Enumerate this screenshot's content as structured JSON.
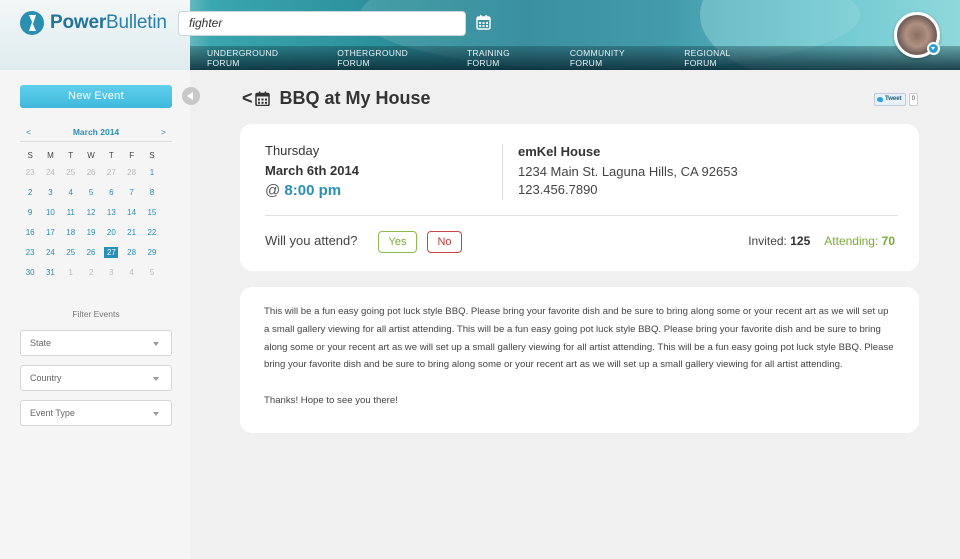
{
  "header": {
    "logo_part1": "Power",
    "logo_part2": "Bulletin",
    "search_value": "fighter",
    "nav": [
      "UNDERGROUND FORUM",
      "OTHERGROUND FORUM",
      "TRAINING FORUM",
      "COMMUNITY FORUM",
      "REGIONAL FORUM"
    ]
  },
  "sidebar": {
    "new_event_label": "New Event",
    "calendar": {
      "prev": "<",
      "month": "March 2014",
      "next": ">",
      "dow": [
        "S",
        "M",
        "T",
        "W",
        "T",
        "F",
        "S"
      ],
      "weeks": [
        [
          "23",
          "24",
          "25",
          "26",
          "27",
          "28",
          "1"
        ],
        [
          "2",
          "3",
          "4",
          "5",
          "6",
          "7",
          "8"
        ],
        [
          "9",
          "10",
          "11",
          "12",
          "13",
          "14",
          "15"
        ],
        [
          "16",
          "17",
          "18",
          "19",
          "20",
          "21",
          "22"
        ],
        [
          "23",
          "24",
          "25",
          "26",
          "27",
          "28",
          "29"
        ],
        [
          "30",
          "31",
          "1",
          "2",
          "3",
          "4",
          "5"
        ]
      ],
      "selected": "27"
    },
    "filter_title": "Filter Events",
    "filters": [
      "State",
      "Country",
      "Event Type"
    ]
  },
  "event": {
    "title": "BBQ at My House",
    "back": "<",
    "tweet_label": "Tweet",
    "tweet_count": "0",
    "day": "Thursday",
    "date": "March 6th 2014",
    "time_prefix": "@ ",
    "time": "8:00 pm",
    "venue": "emKel House",
    "address": "1234 Main St. Laguna Hills, CA 92653",
    "phone": "123.456.7890",
    "attend_question": "Will you attend?",
    "yes_label": "Yes",
    "no_label": "No",
    "invited_label": "Invited: ",
    "invited_count": "125",
    "attending_label": "Attending: ",
    "attending_count": "70",
    "description": "This will be a fun easy going pot luck style BBQ. Please bring your favorite dish and be sure to bring along some or your recent art as we will set up a small gallery viewing for all artist attending.  This will be a fun easy going pot luck style BBQ. Please bring your favorite dish and be sure to bring along some or your recent art as we will set up a small gallery viewing for all artist attending.  This will be a fun easy going pot luck style BBQ. Please bring your favorite dish and be sure to bring along some or your recent art as we will set up a small gallery viewing for all artist attending.",
    "closing": "Thanks! Hope to see you there!"
  },
  "colors": {
    "accent": "#2a8fb8",
    "attending": "#7aaa35",
    "no": "#c23a3a"
  }
}
